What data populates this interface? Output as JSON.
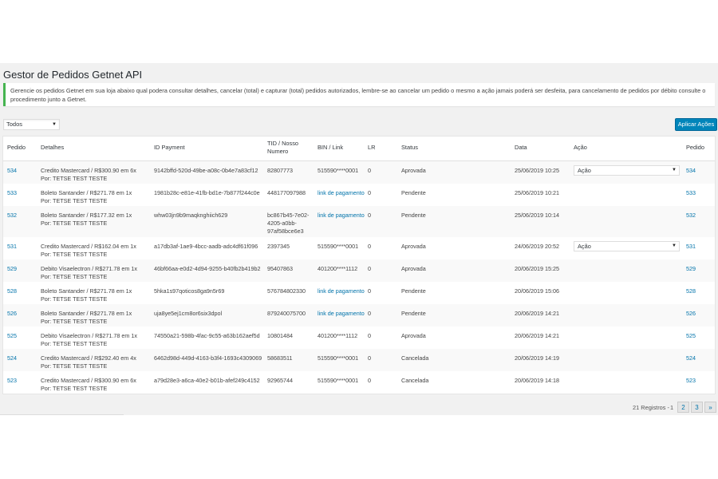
{
  "page": {
    "title": "Gestor de Pedidos Getnet API",
    "notice": "Gerencie os pedidos Getnet em sua loja abaixo qual podera consultar detalhes, cancelar (total) e capturar (total) pedidos autorizados, lembre-se ao cancelar um pedido o mesmo a ação jamais poderá ser desfeita, para cancelamento de pedidos por débito consulte o procedimento junto a Getnet."
  },
  "filter": {
    "selected": "Todos"
  },
  "apply_button": "Aplicar Ações",
  "table": {
    "headers": [
      "Pedido",
      "Detalhes",
      "ID Payment",
      "TID / Nosso Numero",
      "BIN / Link",
      "LR",
      "Status",
      "Data",
      "Ação",
      "Pedido"
    ],
    "rows": [
      {
        "pedido": "534",
        "detalhes": "Credito Mastercard / R$300.90 em 6x",
        "por": "Por: TETSE TEST TESTE",
        "id_payment": "9142bffd-520d-49be-a08c-0b4e7a83cf12",
        "tid": "82807773",
        "bin": "515590****0001",
        "lr": "0",
        "status": "Aprovada",
        "data": "25/06/2019 10:25",
        "acao": "Ação",
        "pedido2": "534"
      },
      {
        "pedido": "533",
        "detalhes": "Boleto Santander / R$271.78 em 1x",
        "por": "Por: TETSE TEST TESTE",
        "id_payment": "1981b28c-e81e-41fb-bd1e-7b877f244c0e",
        "tid": "448177097988",
        "bin": "link de pagamento",
        "lr": "0",
        "status": "Pendente",
        "data": "25/06/2019 10:21",
        "acao": "",
        "pedido2": "533"
      },
      {
        "pedido": "532",
        "detalhes": "Boleto Santander / R$177.32 em 1x",
        "por": "Por: TETSE TEST TESTE",
        "id_payment": "whw03jn9b9maqknghiich629",
        "tid": "bc867b45-7e02-4205-a0bb-97af58bce6e3",
        "bin": "link de pagamento",
        "lr": "0",
        "status": "Pendente",
        "data": "25/06/2019 10:14",
        "acao": "",
        "pedido2": "532"
      },
      {
        "pedido": "531",
        "detalhes": "Credito Mastercard / R$162.04 em 1x",
        "por": "Por: TETSE TEST TESTE",
        "id_payment": "a17db3af-1ae9-4bcc-aadb-adc4df61f096",
        "tid": "2397345",
        "bin": "515590****0001",
        "lr": "0",
        "status": "Aprovada",
        "data": "24/06/2019 20:52",
        "acao": "Ação",
        "pedido2": "531"
      },
      {
        "pedido": "529",
        "detalhes": "Debito Visaelectron / R$271.78 em 1x",
        "por": "Por: TETSE TEST TESTE",
        "id_payment": "46bf66aa-e0d2-4d94-9255-b40fb2b419b2",
        "tid": "95407863",
        "bin": "401200****1112",
        "lr": "0",
        "status": "Aprovada",
        "data": "20/06/2019 15:25",
        "acao": "",
        "pedido2": "529"
      },
      {
        "pedido": "528",
        "detalhes": "Boleto Santander / R$271.78 em 1x",
        "por": "Por: TETSE TEST TESTE",
        "id_payment": "5hka1s97qoticos8ga9n5r69",
        "tid": "576784802330",
        "bin": "link de pagamento",
        "lr": "0",
        "status": "Pendente",
        "data": "20/06/2019 15:06",
        "acao": "",
        "pedido2": "528"
      },
      {
        "pedido": "526",
        "detalhes": "Boleto Santander / R$271.78 em 1x",
        "por": "Por: TETSE TEST TESTE",
        "id_payment": "uja8ye5ej1cm8or6six3dpol",
        "tid": "879240075700",
        "bin": "link de pagamento",
        "lr": "0",
        "status": "Pendente",
        "data": "20/06/2019 14:21",
        "acao": "",
        "pedido2": "526"
      },
      {
        "pedido": "525",
        "detalhes": "Debito Visaelectron / R$271.78 em 1x",
        "por": "Por: TETSE TEST TESTE",
        "id_payment": "74550a21-598b-4fac-9c55-a63b162aef5d",
        "tid": "10801484",
        "bin": "401200****1112",
        "lr": "0",
        "status": "Aprovada",
        "data": "20/06/2019 14:21",
        "acao": "",
        "pedido2": "525"
      },
      {
        "pedido": "524",
        "detalhes": "Credito Mastercard / R$292.40 em 4x",
        "por": "Por: TETSE TEST TESTE",
        "id_payment": "6462d98d-449d-4163-b3f4-1693c4309069",
        "tid": "58683511",
        "bin": "515590****0001",
        "lr": "0",
        "status": "Cancelada",
        "data": "20/06/2019 14:19",
        "acao": "",
        "pedido2": "524"
      },
      {
        "pedido": "523",
        "detalhes": "Credito Mastercard / R$300.90 em 6x",
        "por": "Por: TETSE TEST TESTE",
        "id_payment": "a79d28e3-a6ca-40e2-b01b-afef249c4152",
        "tid": "92965744",
        "bin": "515590****0001",
        "lr": "0",
        "status": "Cancelada",
        "data": "20/06/2019 14:18",
        "acao": "",
        "pedido2": "523"
      }
    ]
  },
  "pagination": {
    "total": "21 Registros -",
    "current": "1",
    "pages": [
      "2",
      "3"
    ],
    "next": "»"
  },
  "colors": {
    "link": "#0073aa",
    "button": "#0085ba",
    "notice_border": "#46b450"
  }
}
